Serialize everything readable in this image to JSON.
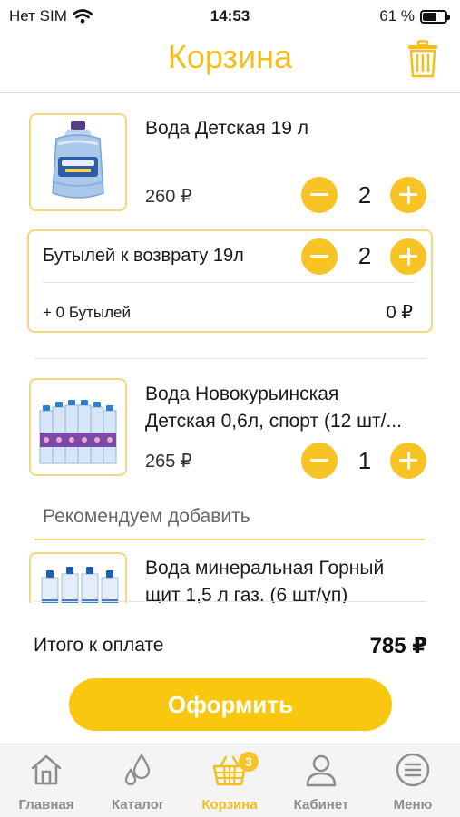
{
  "status": {
    "carrier": "Нет SIM",
    "time": "14:53",
    "battery": "61 %",
    "battery_level": 0.61
  },
  "header": {
    "title": "Корзина",
    "trash_icon": "trash-icon"
  },
  "cart": {
    "items": [
      {
        "name": "Вода Детская 19 л",
        "price": "260 ₽",
        "qty": "2"
      },
      {
        "name_line1": "Вода Новокурьинская",
        "name_line2": "Детская 0,6л, спорт (12 шт/...",
        "price": "265 ₽",
        "qty": "1"
      }
    ],
    "returns": {
      "label": "Бутылей к возврату 19л",
      "qty": "2",
      "bottles_text": "+ 0 Бутылей",
      "bottles_price": "0 ₽"
    }
  },
  "recommend": {
    "title": "Рекомендуем добавить",
    "items": [
      {
        "name_line1": "Вода минеральная Горный",
        "name_line2": "щит 1,5 л газ. (6 шт/уп)"
      }
    ]
  },
  "summary": {
    "label": "Итого к оплате",
    "total": "785 ₽"
  },
  "checkout": {
    "label": "Оформить"
  },
  "tabbar": {
    "tabs": [
      {
        "label": "Главная",
        "icon": "home-icon"
      },
      {
        "label": "Каталог",
        "icon": "drops-icon"
      },
      {
        "label": "Корзина",
        "icon": "basket-icon",
        "badge": "3",
        "active": true
      },
      {
        "label": "Кабинет",
        "icon": "user-icon"
      },
      {
        "label": "Меню",
        "icon": "menu-icon"
      }
    ]
  },
  "colors": {
    "accent": "#f7c325",
    "title": "#f4bf1e",
    "border": "#f3d77e"
  }
}
